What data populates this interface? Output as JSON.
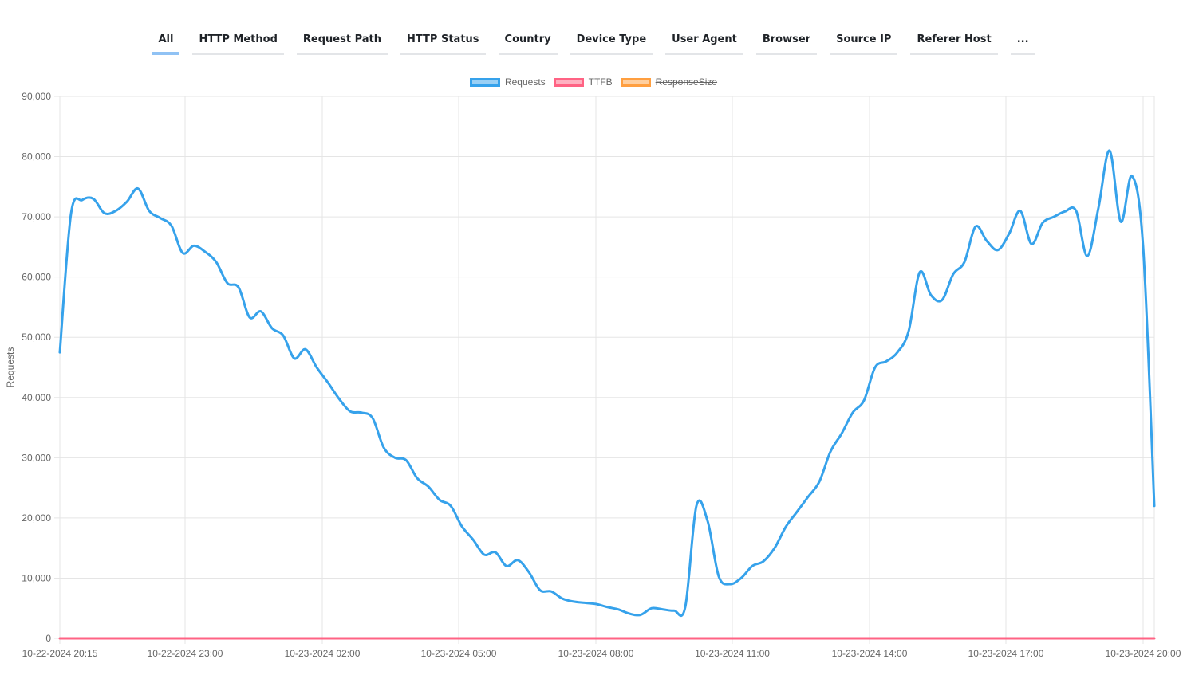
{
  "tabs": [
    {
      "label": "All",
      "active": true
    },
    {
      "label": "HTTP Method"
    },
    {
      "label": "Request Path"
    },
    {
      "label": "HTTP Status"
    },
    {
      "label": "Country"
    },
    {
      "label": "Device Type"
    },
    {
      "label": "User Agent"
    },
    {
      "label": "Browser"
    },
    {
      "label": "Source IP"
    },
    {
      "label": "Referer Host"
    },
    {
      "label": "..."
    }
  ],
  "legend": [
    {
      "label": "Requests",
      "border": "#36a2eb",
      "fill": "#9ad0f5",
      "hidden": false
    },
    {
      "label": "TTFB",
      "border": "#ff6384",
      "fill": "#ffb1c1",
      "hidden": false
    },
    {
      "label": "ResponseSize",
      "border": "#ff9f40",
      "fill": "#ffcf9f",
      "hidden": true
    }
  ],
  "chart_data": {
    "type": "line",
    "ylabel": "Requests",
    "xlabel": "",
    "ylim": [
      0,
      90000
    ],
    "yticks": [
      "0",
      "10,000",
      "20,000",
      "30,000",
      "40,000",
      "50,000",
      "60,000",
      "70,000",
      "80,000",
      "90,000"
    ],
    "xticks": [
      "10-22-2024 20:15",
      "10-22-2024 23:00",
      "10-23-2024 02:00",
      "10-23-2024 05:00",
      "10-23-2024 08:00",
      "10-23-2024 11:00",
      "10-23-2024 14:00",
      "10-23-2024 17:00",
      "10-23-2024 20:00"
    ],
    "grid": true,
    "legend_position": "top",
    "x_start": "10-22-2024 20:15",
    "x_interval_minutes": 15,
    "series": [
      {
        "name": "Requests",
        "color": "#36a2eb",
        "values": [
          47500,
          70500,
          72800,
          73000,
          70600,
          71000,
          72500,
          74700,
          71000,
          69800,
          68500,
          64000,
          65200,
          64200,
          62500,
          59000,
          58300,
          53300,
          54300,
          51500,
          50300,
          46500,
          48000,
          45000,
          42500,
          39800,
          37700,
          37500,
          36600,
          31700,
          30000,
          29600,
          26600,
          25200,
          23000,
          22000,
          18600,
          16400,
          13900,
          14300,
          12000,
          13000,
          11000,
          8000,
          7800,
          6600,
          6100,
          5900,
          5700,
          5200,
          4800,
          4100,
          3900,
          5000,
          4800,
          4600,
          5200,
          22000,
          19500,
          10300,
          9000,
          10000,
          12000,
          12800,
          15000,
          18500,
          21000,
          23500,
          26000,
          31000,
          34000,
          37500,
          39500,
          45000,
          46000,
          47500,
          51000,
          60800,
          57000,
          56200,
          60500,
          62500,
          68400,
          66000,
          64500,
          67200,
          71000,
          65500,
          69000,
          70000,
          70900,
          71000,
          63500,
          71500,
          81000,
          69200,
          76800,
          65000,
          22000
        ]
      },
      {
        "name": "TTFB",
        "color": "#ff6384",
        "values": [
          0,
          0,
          0,
          0,
          0,
          0,
          0,
          0,
          0,
          0,
          0,
          0,
          0,
          0,
          0,
          0,
          0,
          0,
          0,
          0,
          0,
          0,
          0,
          0,
          0,
          0,
          0,
          0,
          0,
          0,
          0,
          0,
          0,
          0,
          0,
          0,
          0,
          0,
          0,
          0,
          0,
          0,
          0,
          0,
          0,
          0,
          0,
          0,
          0,
          0,
          0,
          0,
          0,
          0,
          0,
          0,
          0,
          0,
          0,
          0,
          0,
          0,
          0,
          0,
          0,
          0,
          0,
          0,
          0,
          0,
          0,
          0,
          0,
          0,
          0,
          0,
          0,
          0,
          0,
          0,
          0,
          0,
          0,
          0,
          0,
          0,
          0,
          0,
          0,
          0,
          0,
          0,
          0,
          0,
          0,
          0,
          0,
          0,
          0
        ]
      }
    ]
  }
}
